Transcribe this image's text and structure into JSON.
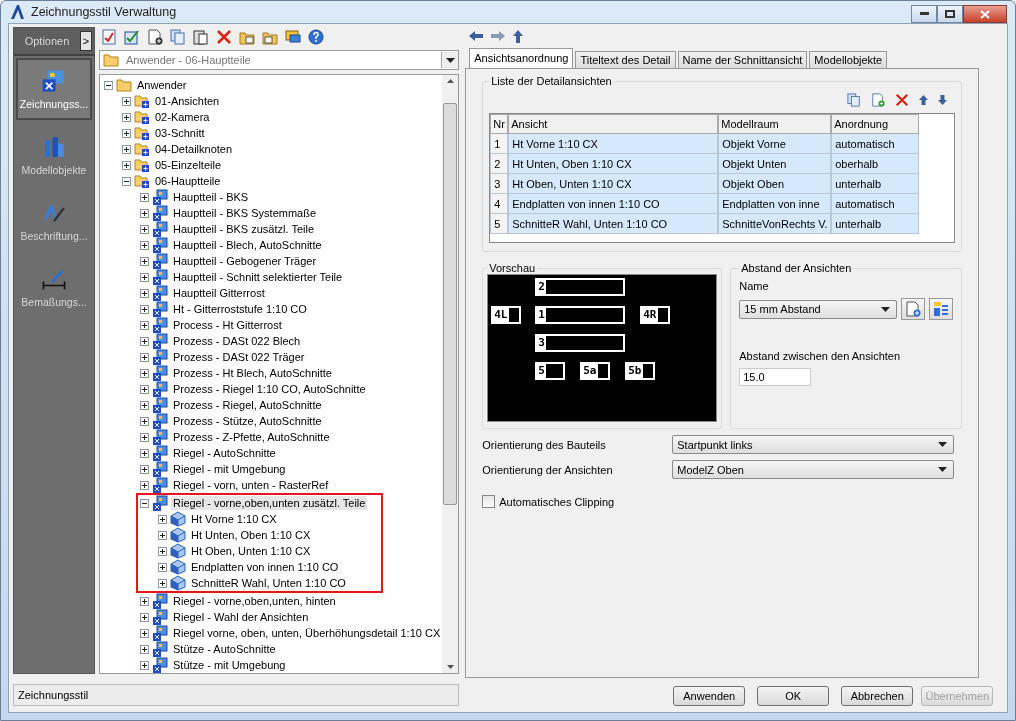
{
  "window": {
    "title": "Zeichnungsstil Verwaltung"
  },
  "sidebar": {
    "header": "Optionen",
    "toggle": ">",
    "items": [
      {
        "label": "Zeichnungss...",
        "kind": "styles",
        "selected": true
      },
      {
        "label": "Modellobjekte",
        "kind": "objects",
        "selected": false
      },
      {
        "label": "Beschriftung...",
        "kind": "labels",
        "selected": false
      },
      {
        "label": "Bemaßungs...",
        "kind": "dimensions",
        "selected": false
      }
    ]
  },
  "path_dropdown": {
    "value": "Anwender - 06-Hauptteile"
  },
  "tree": {
    "label": "Anwender",
    "kind": "folder",
    "expanded": true,
    "children": [
      {
        "label": "01-Ansichten",
        "kind": "category",
        "expanded": false
      },
      {
        "label": "02-Kamera",
        "kind": "category",
        "expanded": false
      },
      {
        "label": "03-Schnitt",
        "kind": "category",
        "expanded": false
      },
      {
        "label": "04-Detailknoten",
        "kind": "category",
        "expanded": false
      },
      {
        "label": "05-Einzelteile",
        "kind": "category",
        "expanded": false
      },
      {
        "label": "06-Hauptteile",
        "kind": "category",
        "expanded": true,
        "children": [
          {
            "label": "Hauptteil - BKS",
            "kind": "style",
            "expanded": false,
            "selected": false,
            "outlined": false
          },
          {
            "label": "Hauptteil - BKS Systemmaße",
            "kind": "style",
            "expanded": false,
            "selected": false,
            "outlined": false
          },
          {
            "label": "Hauptteil - BKS zusätzl. Teile",
            "kind": "style",
            "expanded": false,
            "selected": false,
            "outlined": false
          },
          {
            "label": "Hauptteil - Blech, AutoSchnitte",
            "kind": "style",
            "expanded": false,
            "selected": false,
            "outlined": false
          },
          {
            "label": "Hauptteil - Gebogener Träger",
            "kind": "style",
            "expanded": false,
            "selected": false,
            "outlined": false
          },
          {
            "label": "Hauptteil - Schnitt selektierter Teile",
            "kind": "style",
            "expanded": false,
            "selected": false,
            "outlined": false
          },
          {
            "label": "Hauptteil Gitterrost",
            "kind": "style",
            "expanded": false,
            "selected": false,
            "outlined": false
          },
          {
            "label": "Ht - Gitterroststufe 1:10 CO",
            "kind": "style",
            "expanded": false,
            "selected": false,
            "outlined": false
          },
          {
            "label": "Process - Ht Gitterrost",
            "kind": "style",
            "expanded": false,
            "selected": false,
            "outlined": false
          },
          {
            "label": "Prozess - DASt 022 Blech",
            "kind": "style",
            "expanded": false,
            "selected": false,
            "outlined": false
          },
          {
            "label": "Prozess - DASt 022 Träger",
            "kind": "style",
            "expanded": false,
            "selected": false,
            "outlined": false
          },
          {
            "label": "Prozess - Ht Blech, AutoSchnitte",
            "kind": "style",
            "expanded": false,
            "selected": false,
            "outlined": false
          },
          {
            "label": "Prozess - Riegel 1:10 CO, AutoSchnitte",
            "kind": "style",
            "expanded": false,
            "selected": false,
            "outlined": false
          },
          {
            "label": "Prozess - Riegel, AutoSchnitte",
            "kind": "style",
            "expanded": false,
            "selected": false,
            "outlined": false
          },
          {
            "label": "Prozess - Stütze, AutoSchnitte",
            "kind": "style",
            "expanded": false,
            "selected": false,
            "outlined": false
          },
          {
            "label": "Prozess - Z-Pfette, AutoSchnitte",
            "kind": "style",
            "expanded": false,
            "selected": false,
            "outlined": false
          },
          {
            "label": "Riegel - AutoSchnitte",
            "kind": "style",
            "expanded": false,
            "selected": false,
            "outlined": false
          },
          {
            "label": "Riegel - mit Umgebung",
            "kind": "style",
            "expanded": false,
            "selected": false,
            "outlined": false
          },
          {
            "label": "Riegel - vorn, unten - RasterRef",
            "kind": "style",
            "expanded": false,
            "selected": false,
            "outlined": false
          },
          {
            "label": "Riegel - vorne,oben,unten zusätzl. Teile",
            "kind": "style",
            "expanded": true,
            "selected": true,
            "outlined": true,
            "children": [
              {
                "label": "Ht Vorne 1:10 CX",
                "kind": "view",
                "expanded": false
              },
              {
                "label": "Ht Unten, Oben 1:10 CX",
                "kind": "view",
                "expanded": false
              },
              {
                "label": "Ht Oben, Unten 1:10 CX",
                "kind": "view",
                "expanded": false
              },
              {
                "label": "Endplatten von innen 1:10 CO",
                "kind": "view",
                "expanded": false
              },
              {
                "label": "SchnitteR Wahl, Unten 1:10 CO",
                "kind": "view",
                "expanded": false
              }
            ]
          },
          {
            "label": "Riegel - vorne,oben,unten, hinten",
            "kind": "style",
            "expanded": false,
            "selected": false,
            "outlined": false
          },
          {
            "label": "Riegel - Wahl der Ansichten",
            "kind": "style",
            "expanded": false,
            "selected": false,
            "outlined": false
          },
          {
            "label": "Riegel vorne, oben, unten, Überhöhungsdetail 1:10 CX",
            "kind": "style",
            "expanded": false,
            "selected": false,
            "outlined": false
          },
          {
            "label": "Stütze - AutoSchnitte",
            "kind": "style",
            "expanded": false,
            "selected": false,
            "outlined": false
          },
          {
            "label": "Stütze - mit Umgebung",
            "kind": "style",
            "expanded": false,
            "selected": false,
            "outlined": false
          }
        ]
      }
    ]
  },
  "status_bar": {
    "text": "Zeichnungsstil"
  },
  "tabs": [
    {
      "label": "Ansichtsanordnung",
      "selected": true
    },
    {
      "label": "Titeltext des Detail",
      "selected": false
    },
    {
      "label": "Name der Schnittansicht",
      "selected": false
    },
    {
      "label": "Modellobjekte",
      "selected": false
    }
  ],
  "views_list": {
    "title": "Liste der Detailansichten",
    "columns": [
      "Nr",
      "Ansicht",
      "Modellraum",
      "Anordnung"
    ],
    "rows": [
      {
        "cells": [
          "1",
          "Ht Vorne 1:10 CX",
          "Objekt Vorne",
          "automatisch"
        ],
        "selected": true
      },
      {
        "cells": [
          "2",
          "Ht Unten, Oben 1:10 CX",
          "Objekt Unten",
          "oberhalb"
        ],
        "selected": true
      },
      {
        "cells": [
          "3",
          "Ht Oben, Unten 1:10 CX",
          "Objekt Oben",
          "unterhalb"
        ],
        "selected": true
      },
      {
        "cells": [
          "4",
          "Endplatten von innen 1:10 CO",
          "Endplatten von inne",
          "automatisch"
        ],
        "selected": true
      },
      {
        "cells": [
          "5",
          "SchnitteR Wahl, Unten 1:10 CO",
          "SchnitteVonRechts V.",
          "unterhalb"
        ],
        "selected": true
      }
    ]
  },
  "preview": {
    "title": "Vorschau",
    "views": [
      {
        "label": "2",
        "kind": "wide"
      },
      {
        "label": "4L",
        "kind": "small"
      },
      {
        "label": "1",
        "kind": "wide"
      },
      {
        "label": "4R",
        "kind": "small"
      },
      {
        "label": "3",
        "kind": "wide"
      },
      {
        "label": "5",
        "kind": "small"
      },
      {
        "label": "5a",
        "kind": "small"
      },
      {
        "label": "5b",
        "kind": "small"
      }
    ]
  },
  "spacing": {
    "title": "Abstand der Ansichten",
    "name_label": "Name",
    "name_value": "15 mm Abstand",
    "distance_label": "Abstand zwischen den Ansichten",
    "distance_value": "15.0"
  },
  "orientation": [
    {
      "label": "Orientierung des Bauteils",
      "value": "Startpunkt links"
    },
    {
      "label": "Orientierung der Ansichten",
      "value": "ModelZ Oben"
    }
  ],
  "auto_clipping": {
    "label": "Automatisches Clipping",
    "checked": false
  },
  "buttons": [
    {
      "label": "Anwenden",
      "disabled": false
    },
    {
      "label": "OK",
      "disabled": false
    },
    {
      "label": "Abbrechen",
      "disabled": false
    },
    {
      "label": "Übernehmen",
      "disabled": true
    }
  ]
}
